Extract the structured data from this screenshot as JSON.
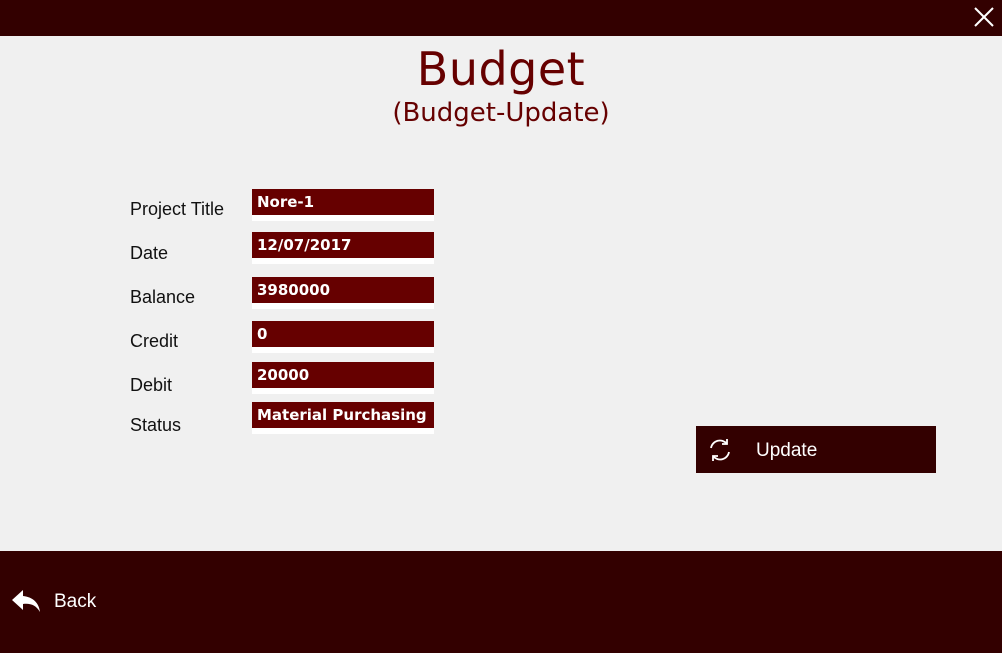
{
  "window": {
    "close_icon": "close-icon"
  },
  "header": {
    "title": "Budget",
    "subtitle": "(Budget-Update)"
  },
  "form": {
    "fields": [
      {
        "label": "Project Title",
        "value": "Nore-1"
      },
      {
        "label": "Date",
        "value": "12/07/2017"
      },
      {
        "label": "Balance",
        "value": "3980000"
      },
      {
        "label": "Credit",
        "value": "0"
      },
      {
        "label": "Debit",
        "value": "20000"
      },
      {
        "label": "Status",
        "value": "Material Purchasing"
      }
    ]
  },
  "actions": {
    "update_label": "Update",
    "update_icon": "refresh-icon"
  },
  "footer": {
    "back_label": "Back",
    "back_icon": "back-arrow-icon"
  },
  "colors": {
    "bar": "#330000",
    "accent": "#660000",
    "background": "#f0f0f0"
  }
}
